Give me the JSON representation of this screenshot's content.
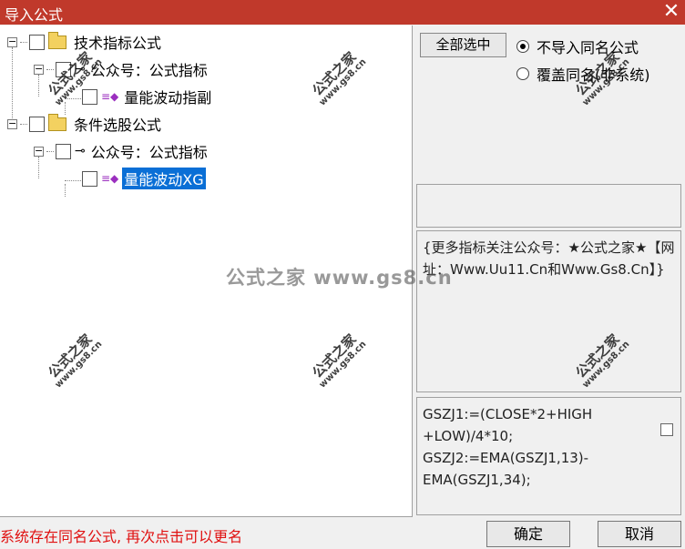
{
  "window": {
    "title": "导入公式",
    "close_glyph": "✕"
  },
  "tree": {
    "nodes": [
      {
        "label": "技术指标公式"
      },
      {
        "label": "公众号：公式指标"
      },
      {
        "label": "量能波动指副"
      },
      {
        "label": "条件选股公式"
      },
      {
        "label": "公众号：公式指标"
      },
      {
        "label": "量能波动XG"
      }
    ],
    "expander_glyph": "−"
  },
  "options": {
    "select_all_label": "全部选中",
    "radio_skip_label": "不导入同名公式",
    "radio_overwrite_label": "覆盖同名(非系统)",
    "selected": "skip"
  },
  "description": "{更多指标关注公众号：★公式之家★【网址：Www.Uu11.Cn和Www.Gs8.Cn】}",
  "code": "GSZJ1:=(CLOSE*2+HIGH\n+LOW)/4*10;\nGSZJ2:=EMA(GSZJ1,13)-\nEMA(GSZJ1,34);",
  "status": "系统存在同名公式, 再次点击可以更名",
  "buttons": {
    "ok": "确定",
    "cancel": "取消"
  },
  "watermark": {
    "cn": "公式之家",
    "url": "www.gs8.cn",
    "center": "公式之家 www.gs8.cn"
  },
  "colors": {
    "titlebar": "#c0392b",
    "selection": "#0a6fd6",
    "status_text": "#e01010"
  }
}
